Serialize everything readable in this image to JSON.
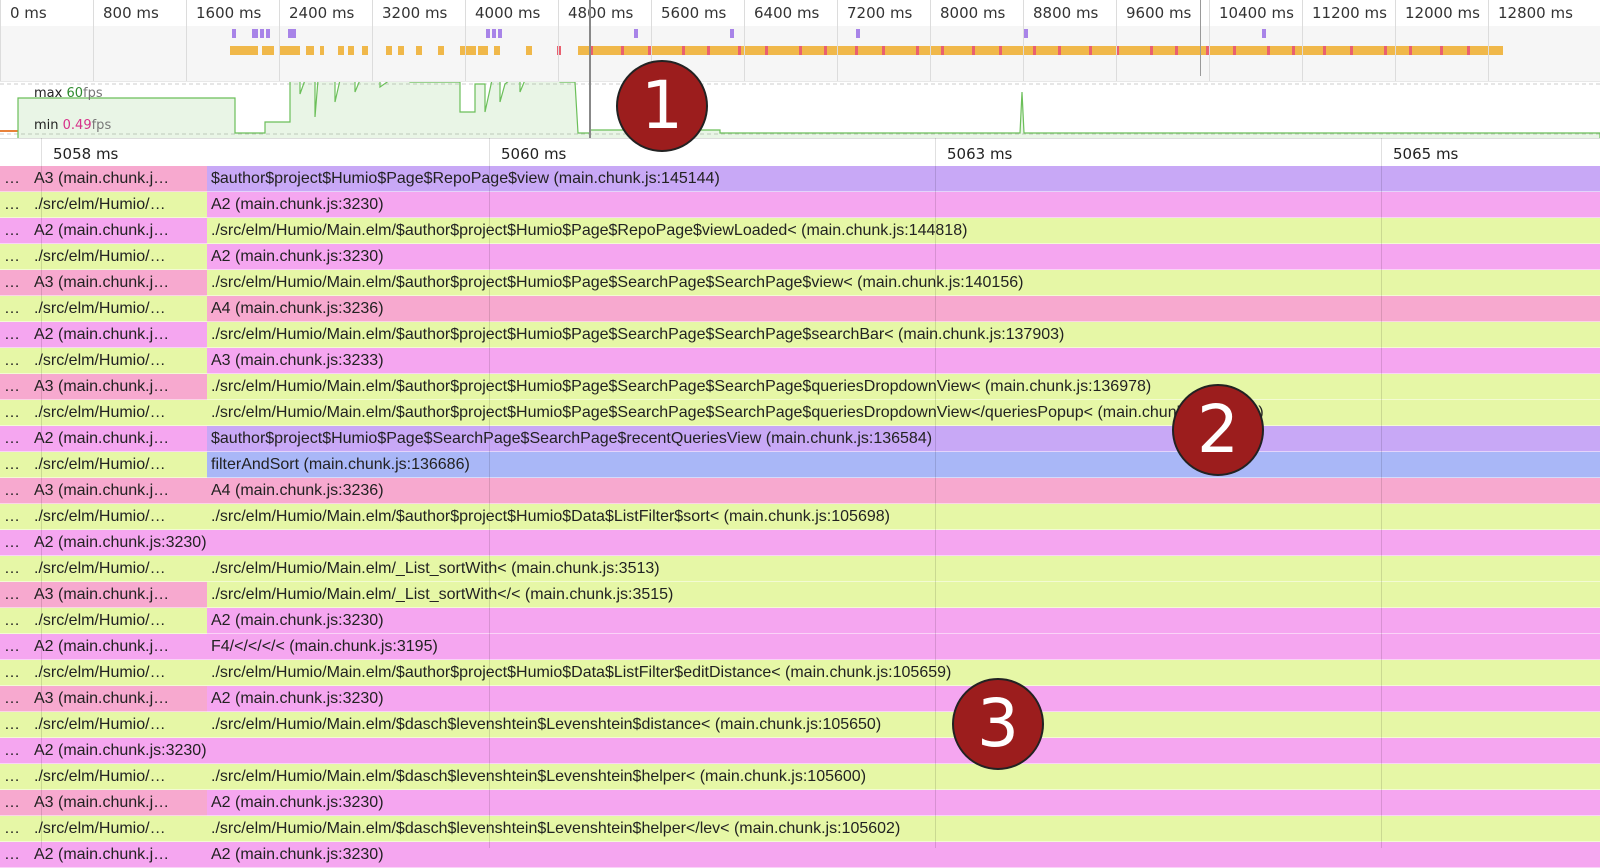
{
  "overview": {
    "ticks": [
      "0 ms",
      "800 ms",
      "1600 ms",
      "2400 ms",
      "3200 ms",
      "4000 ms",
      "4800 ms",
      "5600 ms",
      "6400 ms",
      "7200 ms",
      "8000 ms",
      "8800 ms",
      "9600 ms",
      "10400 ms",
      "11200 ms",
      "12000 ms",
      "12800 ms"
    ]
  },
  "fps": {
    "max_label": "max",
    "max_value": "60",
    "unit": "fps",
    "min_label": "min",
    "min_value": "0.49"
  },
  "flame": {
    "ticks": [
      "5058 ms",
      "5060 ms",
      "5063 ms",
      "5065 ms"
    ]
  },
  "colors": {
    "pink": "#f7a9cf",
    "yellow": "#e6f7a6",
    "magenta": "#f5a6f0",
    "purple": "#c8a8f6",
    "blue": "#a9b7f7",
    "overview_orange": "#f0b84a",
    "overview_red": "#e96070",
    "overview_purple": "#a884e8",
    "fps_green": "#6bbf59"
  },
  "badges": [
    "1",
    "2",
    "3"
  ],
  "rows": [
    {
      "c1": "…",
      "c2": "A3 (main.chunk.j…",
      "c3": "$author$project$Humio$Page$RepoPage$view (main.chunk.js:145144)",
      "b1": "pink",
      "b2": "pink",
      "b3": "purple"
    },
    {
      "c1": "…",
      "c2": "./src/elm/Humio/…",
      "c3": "A2 (main.chunk.js:3230)",
      "b1": "yellow",
      "b2": "yellow",
      "b3": "magenta"
    },
    {
      "c1": "…",
      "c2": "A2 (main.chunk.j…",
      "c3": "./src/elm/Humio/Main.elm/$author$project$Humio$Page$RepoPage$viewLoaded< (main.chunk.js:144818)",
      "b1": "magenta",
      "b2": "magenta",
      "b3": "yellow"
    },
    {
      "c1": "…",
      "c2": "./src/elm/Humio/…",
      "c3": "A2 (main.chunk.js:3230)",
      "b1": "yellow",
      "b2": "yellow",
      "b3": "magenta"
    },
    {
      "c1": "…",
      "c2": "A3 (main.chunk.j…",
      "c3": "./src/elm/Humio/Main.elm/$author$project$Humio$Page$SearchPage$SearchPage$view< (main.chunk.js:140156)",
      "b1": "pink",
      "b2": "pink",
      "b3": "yellow"
    },
    {
      "c1": "…",
      "c2": "./src/elm/Humio/…",
      "c3": "A4 (main.chunk.js:3236)",
      "b1": "yellow",
      "b2": "yellow",
      "b3": "pink"
    },
    {
      "c1": "…",
      "c2": "A2 (main.chunk.j…",
      "c3": "./src/elm/Humio/Main.elm/$author$project$Humio$Page$SearchPage$SearchPage$searchBar< (main.chunk.js:137903)",
      "b1": "magenta",
      "b2": "magenta",
      "b3": "yellow"
    },
    {
      "c1": "…",
      "c2": "./src/elm/Humio/…",
      "c3": "A3 (main.chunk.js:3233)",
      "b1": "yellow",
      "b2": "yellow",
      "b3": "magenta"
    },
    {
      "c1": "…",
      "c2": "A3 (main.chunk.j…",
      "c3": "./src/elm/Humio/Main.elm/$author$project$Humio$Page$SearchPage$SearchPage$queriesDropdownView< (main.chunk.js:136978)",
      "b1": "pink",
      "b2": "pink",
      "b3": "yellow"
    },
    {
      "c1": "…",
      "c2": "./src/elm/Humio/…",
      "c3": "./src/elm/Humio/Main.elm/$author$project$Humio$Page$SearchPage$SearchPage$queriesDropdownView</queriesPopup< (main.chunk.js:137031)",
      "b1": "yellow",
      "b2": "yellow",
      "b3": "yellow"
    },
    {
      "c1": "…",
      "c2": "A2 (main.chunk.j…",
      "c3": "$author$project$Humio$Page$SearchPage$SearchPage$recentQueriesView (main.chunk.js:136584)",
      "b1": "magenta",
      "b2": "magenta",
      "b3": "purple"
    },
    {
      "c1": "…",
      "c2": "./src/elm/Humio/…",
      "c3": "filterAndSort (main.chunk.js:136686)",
      "b1": "yellow",
      "b2": "yellow",
      "b3": "blue"
    },
    {
      "c1": "…",
      "c2": "A3 (main.chunk.j…",
      "c3": "A4 (main.chunk.js:3236)",
      "b1": "pink",
      "b2": "pink",
      "b3": "pink"
    },
    {
      "c1": "…",
      "c2": "./src/elm/Humio/…",
      "c3": "./src/elm/Humio/Main.elm/$author$project$Humio$Data$ListFilter$sort< (main.chunk.js:105698)",
      "b1": "yellow",
      "b2": "yellow",
      "b3": "yellow"
    },
    {
      "c1": "…",
      "c2": "A2 (main.chunk.js:3230)",
      "c3": "",
      "b1": "magenta",
      "b2": "magenta",
      "b3": "magenta",
      "wide": true
    },
    {
      "c1": "…",
      "c2": "./src/elm/Humio/…",
      "c3": "./src/elm/Humio/Main.elm/_List_sortWith< (main.chunk.js:3513)",
      "b1": "yellow",
      "b2": "yellow",
      "b3": "yellow"
    },
    {
      "c1": "…",
      "c2": "A3 (main.chunk.j…",
      "c3": "./src/elm/Humio/Main.elm/_List_sortWith</< (main.chunk.js:3515)",
      "b1": "pink",
      "b2": "pink",
      "b3": "yellow"
    },
    {
      "c1": "…",
      "c2": "./src/elm/Humio/…",
      "c3": "A2 (main.chunk.js:3230)",
      "b1": "yellow",
      "b2": "yellow",
      "b3": "magenta"
    },
    {
      "c1": "…",
      "c2": "A2 (main.chunk.j…",
      "c3": "F4/</</</< (main.chunk.js:3195)",
      "b1": "magenta",
      "b2": "magenta",
      "b3": "magenta"
    },
    {
      "c1": "…",
      "c2": "./src/elm/Humio/…",
      "c3": "./src/elm/Humio/Main.elm/$author$project$Humio$Data$ListFilter$editDistance< (main.chunk.js:105659)",
      "b1": "yellow",
      "b2": "yellow",
      "b3": "yellow"
    },
    {
      "c1": "…",
      "c2": "A3 (main.chunk.j…",
      "c3": "A2 (main.chunk.js:3230)",
      "b1": "pink",
      "b2": "pink",
      "b3": "magenta"
    },
    {
      "c1": "…",
      "c2": "./src/elm/Humio/…",
      "c3": "./src/elm/Humio/Main.elm/$dasch$levenshtein$Levenshtein$distance< (main.chunk.js:105650)",
      "b1": "yellow",
      "b2": "yellow",
      "b3": "yellow"
    },
    {
      "c1": "…",
      "c2": "A2 (main.chunk.js:3230)",
      "c3": "",
      "b1": "magenta",
      "b2": "magenta",
      "b3": "magenta",
      "wide": true
    },
    {
      "c1": "…",
      "c2": "./src/elm/Humio/…",
      "c3": "./src/elm/Humio/Main.elm/$dasch$levenshtein$Levenshtein$helper< (main.chunk.js:105600)",
      "b1": "yellow",
      "b2": "yellow",
      "b3": "yellow"
    },
    {
      "c1": "…",
      "c2": "A3 (main.chunk.j…",
      "c3": "A2 (main.chunk.js:3230)",
      "b1": "pink",
      "b2": "pink",
      "b3": "magenta"
    },
    {
      "c1": "…",
      "c2": "./src/elm/Humio/…",
      "c3": "./src/elm/Humio/Main.elm/$dasch$levenshtein$Levenshtein$helper</lev< (main.chunk.js:105602)",
      "b1": "yellow",
      "b2": "yellow",
      "b3": "yellow"
    },
    {
      "c1": "…",
      "c2": "A2 (main.chunk.j…",
      "c3": "A2 (main.chunk.js:3230)",
      "b1": "magenta",
      "b2": "magenta",
      "b3": "magenta"
    }
  ]
}
